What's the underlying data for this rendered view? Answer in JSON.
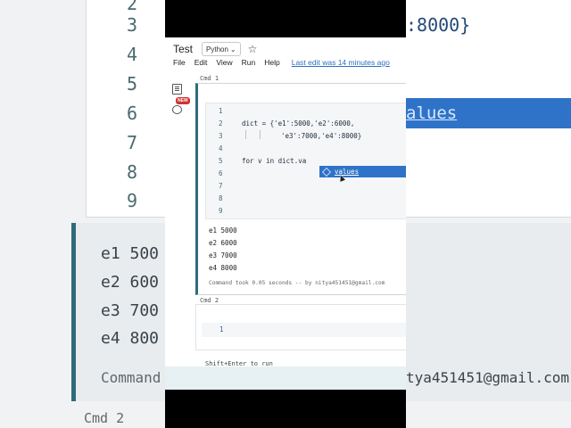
{
  "background": {
    "line_numbers": [
      "3",
      "4",
      "5",
      "6",
      "7",
      "8",
      "9"
    ],
    "first_visible_number": "2",
    "right_code_fragment": ":8000}",
    "highlight_text": "alues",
    "outputs": [
      "e1 500",
      "e2 600",
      "e3 700",
      "e4 800"
    ],
    "cmd_took_prefix": "Command",
    "email_fragment": "tya451451@gmail.com",
    "cmd2_label": "Cmd 2"
  },
  "notebook": {
    "title": "Test",
    "language": "Python",
    "menu": [
      "File",
      "Edit",
      "View",
      "Run",
      "Help"
    ],
    "last_edit": "Last edit was 14 minutes ago",
    "new_badge": "NEW"
  },
  "cell1": {
    "label": "Cmd 1",
    "line_numbers": [
      "1",
      "2",
      "3",
      "4",
      "5",
      "6",
      "7",
      "8",
      "9"
    ],
    "code_line2": "dict = {'e1':5000,'e2':6000,",
    "code_line3": "'e3':7000,'e4':8000}",
    "code_line5": "for v in dict.va",
    "autocomplete": "values",
    "outputs": [
      "e1 5000",
      "e2 6000",
      "e3 7000",
      "e4 8000"
    ],
    "took": "Command took 0.05 seconds -- by nitya451451@gmail.com"
  },
  "cell2": {
    "label": "Cmd 2",
    "line_number": "1",
    "hint": "Shift+Enter to run"
  },
  "colors": {
    "accent": "#2f6b7d",
    "autocomplete_bg": "#2f73c8",
    "link": "#2f6fbf"
  }
}
